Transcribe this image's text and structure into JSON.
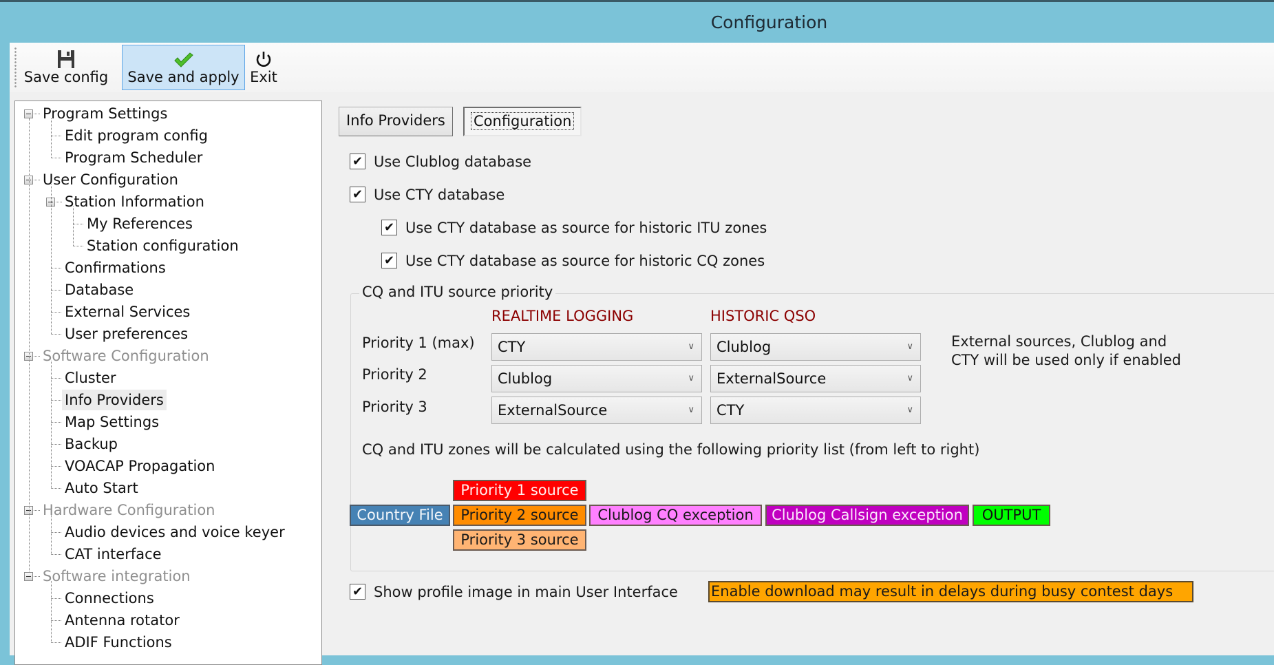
{
  "window": {
    "title": "Configuration"
  },
  "toolbar": {
    "buttons": [
      {
        "label": "Save config",
        "icon": "floppy-disk-icon"
      },
      {
        "label": "Save and apply",
        "icon": "checkmark-icon",
        "hot": true
      },
      {
        "label": "Exit",
        "icon": "power-icon"
      }
    ]
  },
  "tree": {
    "nodes": [
      {
        "label": "Program Settings",
        "level": 0,
        "expanded": true
      },
      {
        "label": "Edit program config",
        "level": 1
      },
      {
        "label": "Program Scheduler",
        "level": 1
      },
      {
        "label": "User Configuration",
        "level": 0,
        "expanded": true
      },
      {
        "label": "Station Information",
        "level": 1,
        "expanded": true
      },
      {
        "label": "My References",
        "level": 2
      },
      {
        "label": "Station configuration",
        "level": 2
      },
      {
        "label": "Confirmations",
        "level": 1
      },
      {
        "label": "Database",
        "level": 1
      },
      {
        "label": "External Services",
        "level": 1
      },
      {
        "label": "User preferences",
        "level": 1
      },
      {
        "label": "Software Configuration",
        "level": 0,
        "expanded": true,
        "disabled": true
      },
      {
        "label": "Cluster",
        "level": 1
      },
      {
        "label": "Info Providers",
        "level": 1,
        "selected": true
      },
      {
        "label": "Map Settings",
        "level": 1
      },
      {
        "label": "Backup",
        "level": 1
      },
      {
        "label": "VOACAP Propagation",
        "level": 1
      },
      {
        "label": "Auto Start",
        "level": 1
      },
      {
        "label": "Hardware Configuration",
        "level": 0,
        "expanded": true,
        "disabled": true
      },
      {
        "label": "Audio devices and voice keyer",
        "level": 1
      },
      {
        "label": "CAT interface",
        "level": 1
      },
      {
        "label": "Software integration",
        "level": 0,
        "expanded": true,
        "disabled": true
      },
      {
        "label": "Connections",
        "level": 1
      },
      {
        "label": "Antenna rotator",
        "level": 1
      },
      {
        "label": "ADIF Functions",
        "level": 1
      }
    ]
  },
  "tabs": [
    {
      "label": "Info Providers",
      "active": false
    },
    {
      "label": "Configuration",
      "active": true
    }
  ],
  "options": {
    "use_clublog": {
      "label": "Use Clublog database",
      "checked": true
    },
    "use_cty": {
      "label": "Use CTY database",
      "checked": true
    },
    "cty_itu": {
      "label": "Use CTY database as source for historic ITU zones",
      "checked": true
    },
    "cty_cq": {
      "label": "Use CTY database as source for historic CQ zones",
      "checked": true
    },
    "show_profile": {
      "label": "Show profile image in main User Interface",
      "checked": true
    }
  },
  "priority_group": {
    "title": "CQ and ITU source priority",
    "col_realtime": "REALTIME LOGGING",
    "col_historic": "HISTORIC QSO",
    "rows": [
      {
        "label": "Priority 1 (max)",
        "realtime": "CTY",
        "historic": "Clublog"
      },
      {
        "label": "Priority 2",
        "realtime": "Clublog",
        "historic": "ExternalSource"
      },
      {
        "label": "Priority 3",
        "realtime": "ExternalSource",
        "historic": "CTY"
      }
    ],
    "note_line1": "External sources, Clublog and",
    "note_line2": "CTY will be used only if enabled",
    "flow_description": "CQ and ITU zones will be calculated using the following priority list (from left to right)",
    "flow": {
      "country_file": {
        "label": "Country File",
        "color": "#4682b4"
      },
      "priority1": {
        "label": "Priority 1 source",
        "color": "#ff0000"
      },
      "priority2": {
        "label": "Priority 2 source",
        "color": "#ff8c00"
      },
      "priority3": {
        "label": "Priority 3 source",
        "color": "#ffb473"
      },
      "clublog_cq": {
        "label": "Clublog CQ exception",
        "color": "#ff80ff"
      },
      "clublog_callsign": {
        "label": "Clublog Callsign exception",
        "color": "#c000c0"
      },
      "output": {
        "label": "OUTPUT",
        "color": "#00ff00"
      }
    }
  },
  "warning": {
    "text": "Enable download may result in delays during busy contest days",
    "color": "#ffa500"
  }
}
